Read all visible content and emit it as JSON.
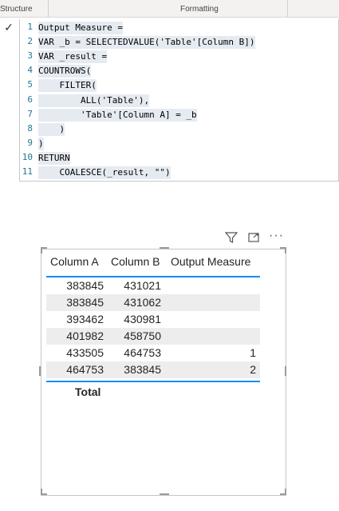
{
  "ribbon": {
    "left_label": "Structure",
    "right_label": "Formatting"
  },
  "editor": {
    "check_symbol": "✓",
    "lines": [
      {
        "no": "1",
        "text": "Output Measure ="
      },
      {
        "no": "2",
        "text": "VAR _b = SELECTEDVALUE('Table'[Column B])"
      },
      {
        "no": "3",
        "text": "VAR _result ="
      },
      {
        "no": "4",
        "text": "COUNTROWS("
      },
      {
        "no": "5",
        "text": "    FILTER("
      },
      {
        "no": "6",
        "text": "        ALL('Table'),"
      },
      {
        "no": "7",
        "text": "        'Table'[Column A] = _b"
      },
      {
        "no": "8",
        "text": "    )"
      },
      {
        "no": "9",
        "text": ")"
      },
      {
        "no": "10",
        "text": "RETURN"
      },
      {
        "no": "11",
        "text": "    COALESCE(_result, \"\")"
      }
    ]
  },
  "visual": {
    "icons": [
      "filter-icon",
      "focus-mode-icon",
      "more-options-icon"
    ],
    "columns": [
      "Column A",
      "Column B",
      "Output Measure"
    ],
    "rows": [
      {
        "a": "383845",
        "b": "431021",
        "m": ""
      },
      {
        "a": "383845",
        "b": "431062",
        "m": ""
      },
      {
        "a": "393462",
        "b": "430981",
        "m": ""
      },
      {
        "a": "401982",
        "b": "458750",
        "m": ""
      },
      {
        "a": "433505",
        "b": "464753",
        "m": "1"
      },
      {
        "a": "464753",
        "b": "383845",
        "m": "2"
      }
    ],
    "total_label": "Total"
  }
}
